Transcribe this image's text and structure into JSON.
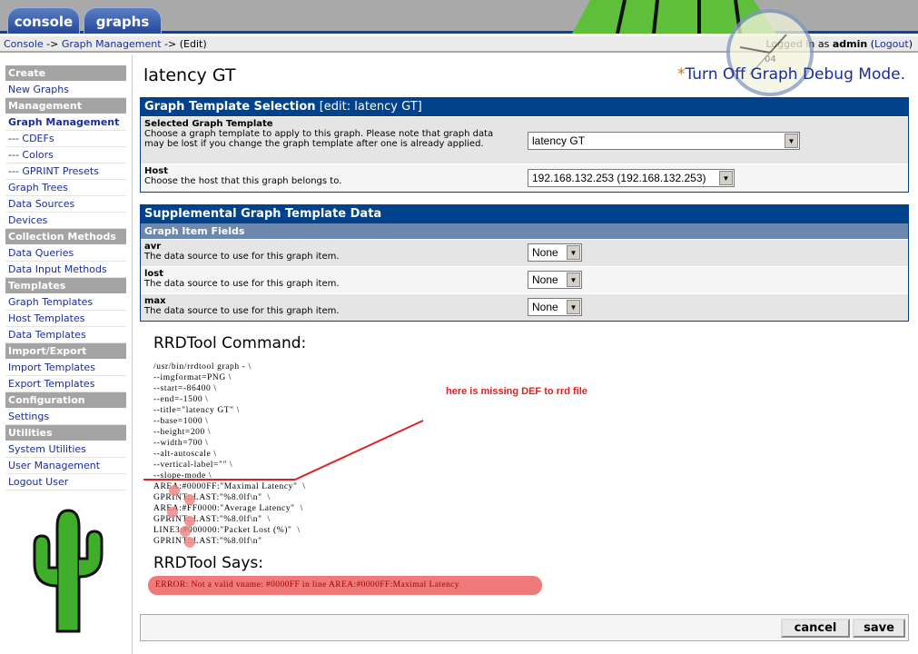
{
  "tabs": [
    {
      "label": "console"
    },
    {
      "label": "graphs"
    }
  ],
  "breadcrumb": {
    "console": "Console",
    "sep1": " -> ",
    "graph_management": "Graph Management",
    "sep2": " -> (Edit)"
  },
  "login": {
    "prefix": "Logged in as ",
    "user": "admin",
    "open": " (",
    "logout": "Logout",
    "close": ")"
  },
  "clock": {
    "date": "04"
  },
  "sidebar": {
    "items": [
      {
        "label": "Create",
        "type": "header"
      },
      {
        "label": "New Graphs"
      },
      {
        "label": "Management",
        "type": "header"
      },
      {
        "label": "Graph Management",
        "active": true
      },
      {
        "label": "--- CDEFs"
      },
      {
        "label": "--- Colors"
      },
      {
        "label": "--- GPRINT Presets"
      },
      {
        "label": "Graph Trees"
      },
      {
        "label": "Data Sources"
      },
      {
        "label": "Devices"
      },
      {
        "label": "Collection Methods",
        "type": "header"
      },
      {
        "label": "Data Queries"
      },
      {
        "label": "Data Input Methods"
      },
      {
        "label": "Templates",
        "type": "header"
      },
      {
        "label": "Graph Templates"
      },
      {
        "label": "Host Templates"
      },
      {
        "label": "Data Templates"
      },
      {
        "label": "Import/Export",
        "type": "header"
      },
      {
        "label": "Import Templates"
      },
      {
        "label": "Export Templates"
      },
      {
        "label": "Configuration",
        "type": "header"
      },
      {
        "label": "Settings"
      },
      {
        "label": "Utilities",
        "type": "header"
      },
      {
        "label": "System Utilities"
      },
      {
        "label": "User Management"
      },
      {
        "label": "Logout User"
      }
    ]
  },
  "page": {
    "title": "latency GT",
    "debug_star": "*",
    "debug_link": "Turn Off Graph Debug Mode."
  },
  "template_box": {
    "title": "Graph Template Selection",
    "edit": " [edit: latency GT]",
    "template_label": "Selected Graph Template",
    "template_desc": "Choose a graph template to apply to this graph. Please note that graph data may be lost if you change the graph template after one is already applied.",
    "template_value": "latency GT",
    "host_label": "Host",
    "host_desc": "Choose the host that this graph belongs to.",
    "host_value": "192.168.132.253 (192.168.132.253)"
  },
  "supp_box": {
    "title": "Supplemental Graph Template Data",
    "subheader": "Graph Item Fields",
    "items": [
      {
        "label": "avr",
        "desc": "The data source to use for this graph item.",
        "value": "None"
      },
      {
        "label": "lost",
        "desc": "The data source to use for this graph item.",
        "value": "None"
      },
      {
        "label": "max",
        "desc": "The data source to use for this graph item.",
        "value": "None"
      }
    ]
  },
  "rrd": {
    "command_heading": "RRDTool Command:",
    "command": "/usr/bin/rrdtool graph - \\\n--imgformat=PNG \\\n--start=-86400 \\\n--end=-1500 \\\n--title=\"latency GT\" \\\n--base=1000 \\\n--height=200 \\\n--width=700 \\\n--alt-autoscale \\\n--vertical-label=\"\" \\\n--slope-mode \\\nAREA:#0000FF:\"Maximal Latency\"  \\\nGPRINT::LAST:\"%8.0lf\\n\"  \\\nAREA:#FF0000:\"Average Latency\"  \\\nGPRINT::LAST:\"%8.0lf\\n\"  \\\nLINE3:#000000:\"Packet Lost (%)\"  \\\nGPRINT::LAST:\"%8.0lf\\n\"",
    "says_heading": "RRDTool Says:",
    "error": "ERROR: Not a valid vname: #0000FF in line AREA:#0000FF:Maximal Latency"
  },
  "annotation": {
    "text": "here is missing DEF to rrd file",
    "color": "#e02020"
  },
  "buttons": {
    "cancel": "cancel",
    "save": "save"
  }
}
